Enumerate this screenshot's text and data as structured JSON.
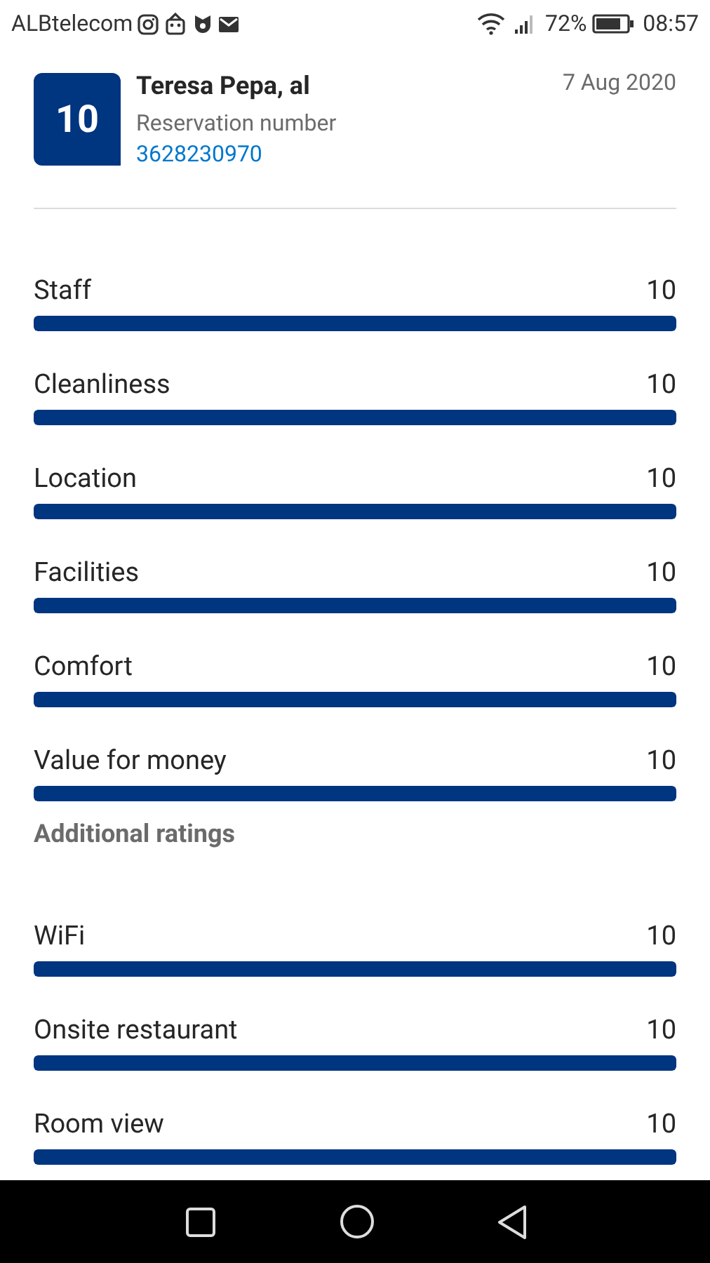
{
  "status_bar": {
    "carrier": "ALBtelecom",
    "battery_percent": "72%",
    "time": "08:57"
  },
  "review": {
    "score": "10",
    "name": "Teresa Pepa, al",
    "reservation_label": "Reservation number",
    "reservation_number": "3628230970",
    "date": "7 Aug 2020"
  },
  "ratings": [
    {
      "label": "Staff",
      "value": "10",
      "level": 1
    },
    {
      "label": "Cleanliness",
      "value": "10",
      "level": 1
    },
    {
      "label": "Location",
      "value": "10",
      "level": 1
    },
    {
      "label": "Facilities",
      "value": "10",
      "level": 1
    },
    {
      "label": "Comfort",
      "value": "10",
      "level": 1
    },
    {
      "label": "Value for money",
      "value": "10",
      "level": 1
    }
  ],
  "additional_heading": "Additional ratings",
  "additional_ratings": [
    {
      "label": "WiFi",
      "value": "10",
      "level": 1
    },
    {
      "label": "Onsite restaurant",
      "value": "10",
      "level": 1
    },
    {
      "label": "Room view",
      "value": "10",
      "level": 1
    }
  ]
}
